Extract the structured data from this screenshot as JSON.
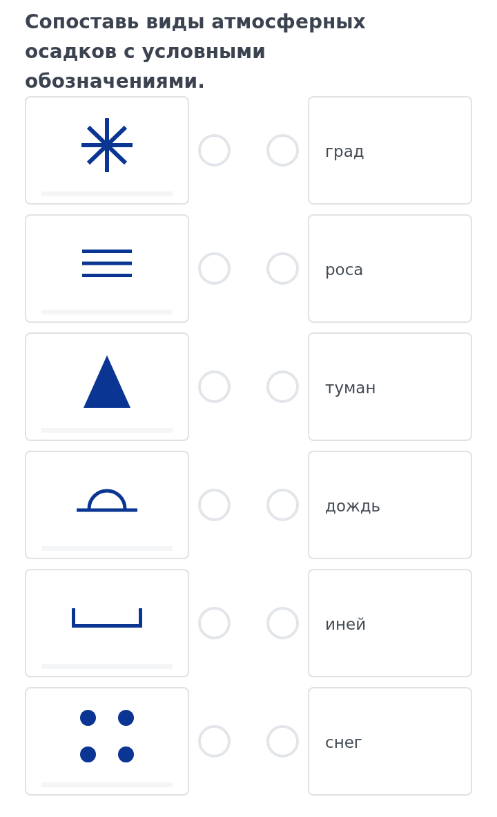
{
  "title": "Сопоставь виды атмосферных осадков с условными обозначениями.",
  "rows": [
    {
      "symbol": {
        "kind": "asterisk",
        "selected": false
      },
      "answer": {
        "label": "град",
        "selected": false
      }
    },
    {
      "symbol": {
        "kind": "triple_line",
        "selected": false
      },
      "answer": {
        "label": "роса",
        "selected": false
      }
    },
    {
      "symbol": {
        "kind": "triangle",
        "selected": false
      },
      "answer": {
        "label": "туман",
        "selected": false
      }
    },
    {
      "symbol": {
        "kind": "arc",
        "selected": false
      },
      "answer": {
        "label": "дождь",
        "selected": false
      }
    },
    {
      "symbol": {
        "kind": "bracket",
        "selected": false
      },
      "answer": {
        "label": "иней",
        "selected": false
      }
    },
    {
      "symbol": {
        "kind": "dots",
        "selected": false
      },
      "answer": {
        "label": "снег",
        "selected": false
      }
    }
  ]
}
